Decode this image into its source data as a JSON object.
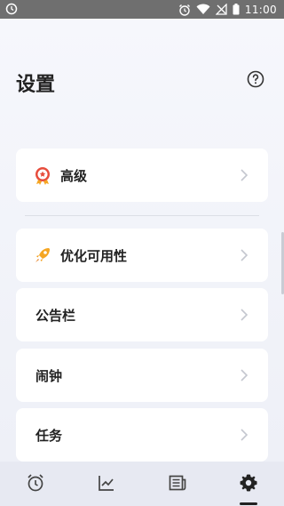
{
  "status_bar": {
    "time": "11:00"
  },
  "page": {
    "title": "设置"
  },
  "items": [
    {
      "label": "高级",
      "icon": "medal-icon"
    },
    {
      "label": "优化可用性",
      "icon": "rocket-icon"
    },
    {
      "label": "公告栏"
    },
    {
      "label": "闹钟"
    },
    {
      "label": "任务"
    }
  ],
  "nav": [
    {
      "name": "alarm-tab",
      "icon": "alarm-clock-icon"
    },
    {
      "name": "stats-tab",
      "icon": "chart-icon"
    },
    {
      "name": "notes-tab",
      "icon": "newspaper-icon"
    },
    {
      "name": "settings-tab",
      "icon": "gear-icon",
      "active": true
    }
  ],
  "colors": {
    "accent_red": "#e74c3c",
    "rocket_orange": "#f5a623",
    "text": "#222222",
    "card_bg": "#ffffff"
  }
}
